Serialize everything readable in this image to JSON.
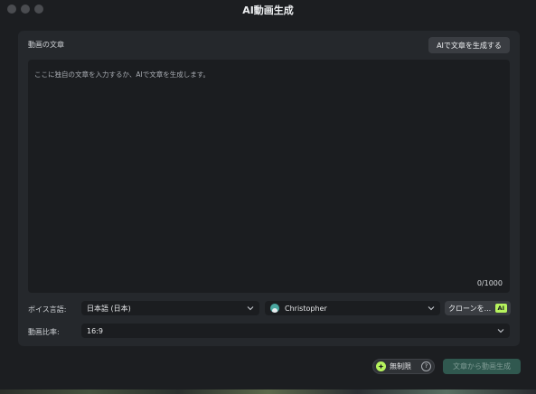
{
  "window": {
    "title": "AI動画生成"
  },
  "script_section": {
    "label": "動画の文章",
    "generate_button": "AIで文章を生成する",
    "placeholder": "ここに独自の文章を入力するか、AIで文章を生成します。",
    "char_count": "0/1000"
  },
  "voice": {
    "label": "ボイス言語:",
    "language": "日本語 (日本)",
    "voice_name": "Christopher",
    "clone_button": "クローンを...",
    "clone_badge": "AI"
  },
  "ratio": {
    "label": "動画比率:",
    "value": "16:9"
  },
  "footer": {
    "unlimited_label": "無制限",
    "help": "?",
    "create_button": "文章から動画生成"
  },
  "colors": {
    "accent": "#b6f35d",
    "primary_disabled": "#30584f"
  }
}
